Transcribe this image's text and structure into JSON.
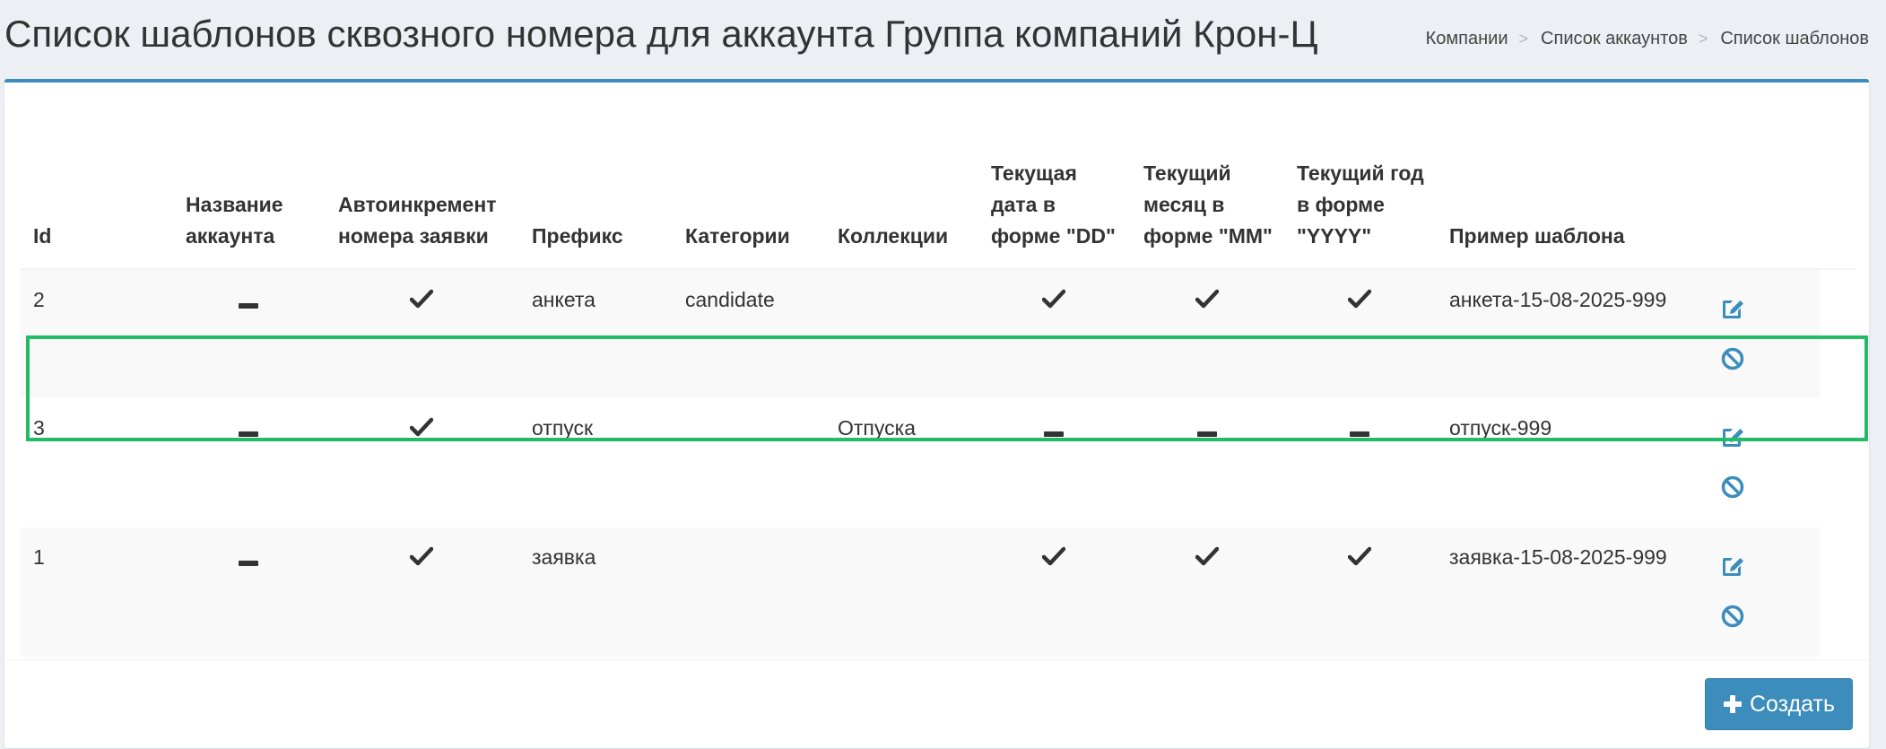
{
  "header": {
    "title": "Список шаблонов сквозного номера для аккаунта Группа компаний Крон-Ц",
    "breadcrumb": [
      "Компании",
      "Список аккаунтов",
      "Список шаблонов"
    ],
    "breadcrumb_separator": ">"
  },
  "table": {
    "columns": [
      "Id",
      "Название аккаунта",
      "Автоинкремент номера заявки",
      "Префикс",
      "Категории",
      "Коллекции",
      "Текущая дата в форме \"DD\"",
      "Текущий месяц в форме \"MM\"",
      "Текущий год в форме \"YYYY\"",
      "Пример шаблона"
    ],
    "rows": [
      {
        "id": "2",
        "account_name": "dash",
        "autoincrement": "check",
        "prefix": "анкета",
        "categories": "candidate",
        "collections": "",
        "day": "check",
        "month": "check",
        "year": "check",
        "example": "анкета-15-08-2025-999",
        "highlighted": true
      },
      {
        "id": "3",
        "account_name": "dash",
        "autoincrement": "check",
        "prefix": "отпуск",
        "categories": "",
        "collections": "Отпуска",
        "day": "dash",
        "month": "dash",
        "year": "dash",
        "example": "отпуск-999",
        "highlighted": false
      },
      {
        "id": "1",
        "account_name": "dash",
        "autoincrement": "check",
        "prefix": "заявка",
        "categories": "",
        "collections": "",
        "day": "check",
        "month": "check",
        "year": "check",
        "example": "заявка-15-08-2025-999",
        "highlighted": false
      }
    ],
    "row_actions": [
      "edit-icon",
      "ban-icon"
    ]
  },
  "footer": {
    "create_label": "Создать",
    "create_icon": "plus-icon"
  },
  "colors": {
    "accent": "#3c8dbc",
    "highlight": "#22bb66",
    "background": "#ecf0f5",
    "stripe": "#f9f9f9"
  }
}
